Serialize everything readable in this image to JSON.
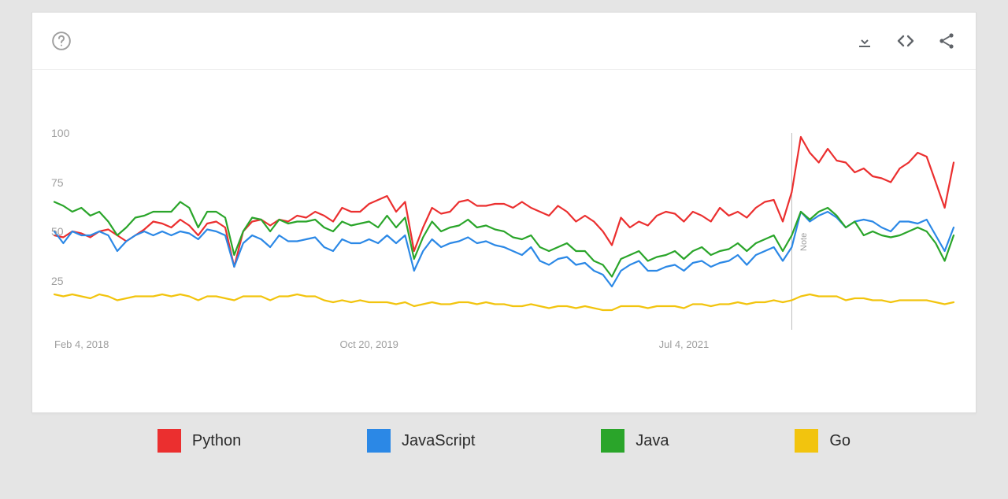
{
  "toolbar": {
    "icons": {
      "help": "help-icon",
      "download": "download-icon",
      "embed": "code-icon",
      "share": "share-icon"
    }
  },
  "noteLabel": "Note",
  "legend": [
    {
      "name": "Python",
      "color": "#eb2f2f"
    },
    {
      "name": "JavaScript",
      "color": "#2b88e6"
    },
    {
      "name": "Java",
      "color": "#2aa52a"
    },
    {
      "name": "Go",
      "color": "#f2c40e"
    }
  ],
  "chart_data": {
    "type": "line",
    "title": "",
    "xlabel": "",
    "ylabel": "",
    "ylim": [
      0,
      100
    ],
    "y_ticks": [
      25,
      50,
      75,
      100
    ],
    "x_tick_labels": [
      "Feb 4, 2018",
      "Oct 20, 2019",
      "Jul 4, 2021"
    ],
    "x_tick_positions": [
      0,
      35,
      70
    ],
    "note_marker_x": 82,
    "x": [
      0,
      1,
      2,
      3,
      4,
      5,
      6,
      7,
      8,
      9,
      10,
      11,
      12,
      13,
      14,
      15,
      16,
      17,
      18,
      19,
      20,
      21,
      22,
      23,
      24,
      25,
      26,
      27,
      28,
      29,
      30,
      31,
      32,
      33,
      34,
      35,
      36,
      37,
      38,
      39,
      40,
      41,
      42,
      43,
      44,
      45,
      46,
      47,
      48,
      49,
      50,
      51,
      52,
      53,
      54,
      55,
      56,
      57,
      58,
      59,
      60,
      61,
      62,
      63,
      64,
      65,
      66,
      67,
      68,
      69,
      70,
      71,
      72,
      73,
      74,
      75,
      76,
      77,
      78,
      79,
      80,
      81,
      82,
      83,
      84,
      85,
      86,
      87,
      88,
      89,
      90,
      91,
      92,
      93,
      94,
      95,
      96,
      97,
      98,
      99,
      100
    ],
    "series": [
      {
        "name": "Python",
        "color": "#eb2f2f",
        "values": [
          48,
          47,
          50,
          49,
          47,
          50,
          51,
          48,
          45,
          48,
          51,
          55,
          54,
          52,
          56,
          53,
          48,
          54,
          55,
          52,
          32,
          50,
          55,
          56,
          53,
          56,
          55,
          58,
          57,
          60,
          58,
          55,
          62,
          60,
          60,
          64,
          66,
          68,
          60,
          65,
          40,
          52,
          62,
          59,
          60,
          65,
          66,
          63,
          63,
          64,
          64,
          62,
          65,
          62,
          60,
          58,
          63,
          60,
          55,
          58,
          55,
          50,
          43,
          57,
          52,
          55,
          53,
          58,
          60,
          59,
          55,
          60,
          58,
          55,
          62,
          58,
          60,
          57,
          62,
          65,
          66,
          55,
          70,
          98,
          90,
          85,
          92,
          86,
          85,
          80,
          82,
          78,
          77,
          75,
          82,
          85,
          90,
          88,
          75,
          62,
          85
        ]
      },
      {
        "name": "JavaScript",
        "color": "#2b88e6",
        "values": [
          50,
          44,
          50,
          48,
          48,
          50,
          48,
          40,
          45,
          48,
          50,
          48,
          50,
          48,
          50,
          49,
          46,
          51,
          50,
          48,
          32,
          44,
          48,
          46,
          42,
          48,
          45,
          45,
          46,
          47,
          42,
          40,
          46,
          44,
          44,
          46,
          44,
          48,
          44,
          48,
          30,
          40,
          46,
          42,
          44,
          45,
          47,
          44,
          45,
          43,
          42,
          40,
          38,
          42,
          35,
          33,
          36,
          37,
          33,
          34,
          30,
          28,
          22,
          30,
          33,
          35,
          30,
          30,
          32,
          33,
          30,
          34,
          35,
          32,
          34,
          35,
          38,
          33,
          38,
          40,
          42,
          35,
          42,
          60,
          55,
          58,
          60,
          57,
          52,
          55,
          56,
          55,
          52,
          50,
          55,
          55,
          54,
          56,
          48,
          40,
          52
        ]
      },
      {
        "name": "Java",
        "color": "#2aa52a",
        "values": [
          65,
          63,
          60,
          62,
          58,
          60,
          55,
          48,
          52,
          57,
          58,
          60,
          60,
          60,
          65,
          62,
          52,
          60,
          60,
          57,
          38,
          50,
          57,
          56,
          50,
          56,
          54,
          55,
          55,
          56,
          52,
          50,
          55,
          53,
          54,
          55,
          52,
          58,
          52,
          57,
          36,
          47,
          55,
          50,
          52,
          53,
          56,
          52,
          53,
          51,
          50,
          47,
          46,
          48,
          42,
          40,
          42,
          44,
          40,
          40,
          35,
          33,
          27,
          36,
          38,
          40,
          35,
          37,
          38,
          40,
          36,
          40,
          42,
          38,
          40,
          41,
          44,
          40,
          44,
          46,
          48,
          40,
          48,
          60,
          56,
          60,
          62,
          58,
          52,
          55,
          48,
          50,
          48,
          47,
          48,
          50,
          52,
          50,
          44,
          35,
          48
        ]
      },
      {
        "name": "Go",
        "color": "#f2c40e",
        "values": [
          18,
          17,
          18,
          17,
          16,
          18,
          17,
          15,
          16,
          17,
          17,
          17,
          18,
          17,
          18,
          17,
          15,
          17,
          17,
          16,
          15,
          17,
          17,
          17,
          15,
          17,
          17,
          18,
          17,
          17,
          15,
          14,
          15,
          14,
          15,
          14,
          14,
          14,
          13,
          14,
          12,
          13,
          14,
          13,
          13,
          14,
          14,
          13,
          14,
          13,
          13,
          12,
          12,
          13,
          12,
          11,
          12,
          12,
          11,
          12,
          11,
          10,
          10,
          12,
          12,
          12,
          11,
          12,
          12,
          12,
          11,
          13,
          13,
          12,
          13,
          13,
          14,
          13,
          14,
          14,
          15,
          14,
          15,
          17,
          18,
          17,
          17,
          17,
          15,
          16,
          16,
          15,
          15,
          14,
          15,
          15,
          15,
          15,
          14,
          13,
          14
        ]
      }
    ]
  }
}
